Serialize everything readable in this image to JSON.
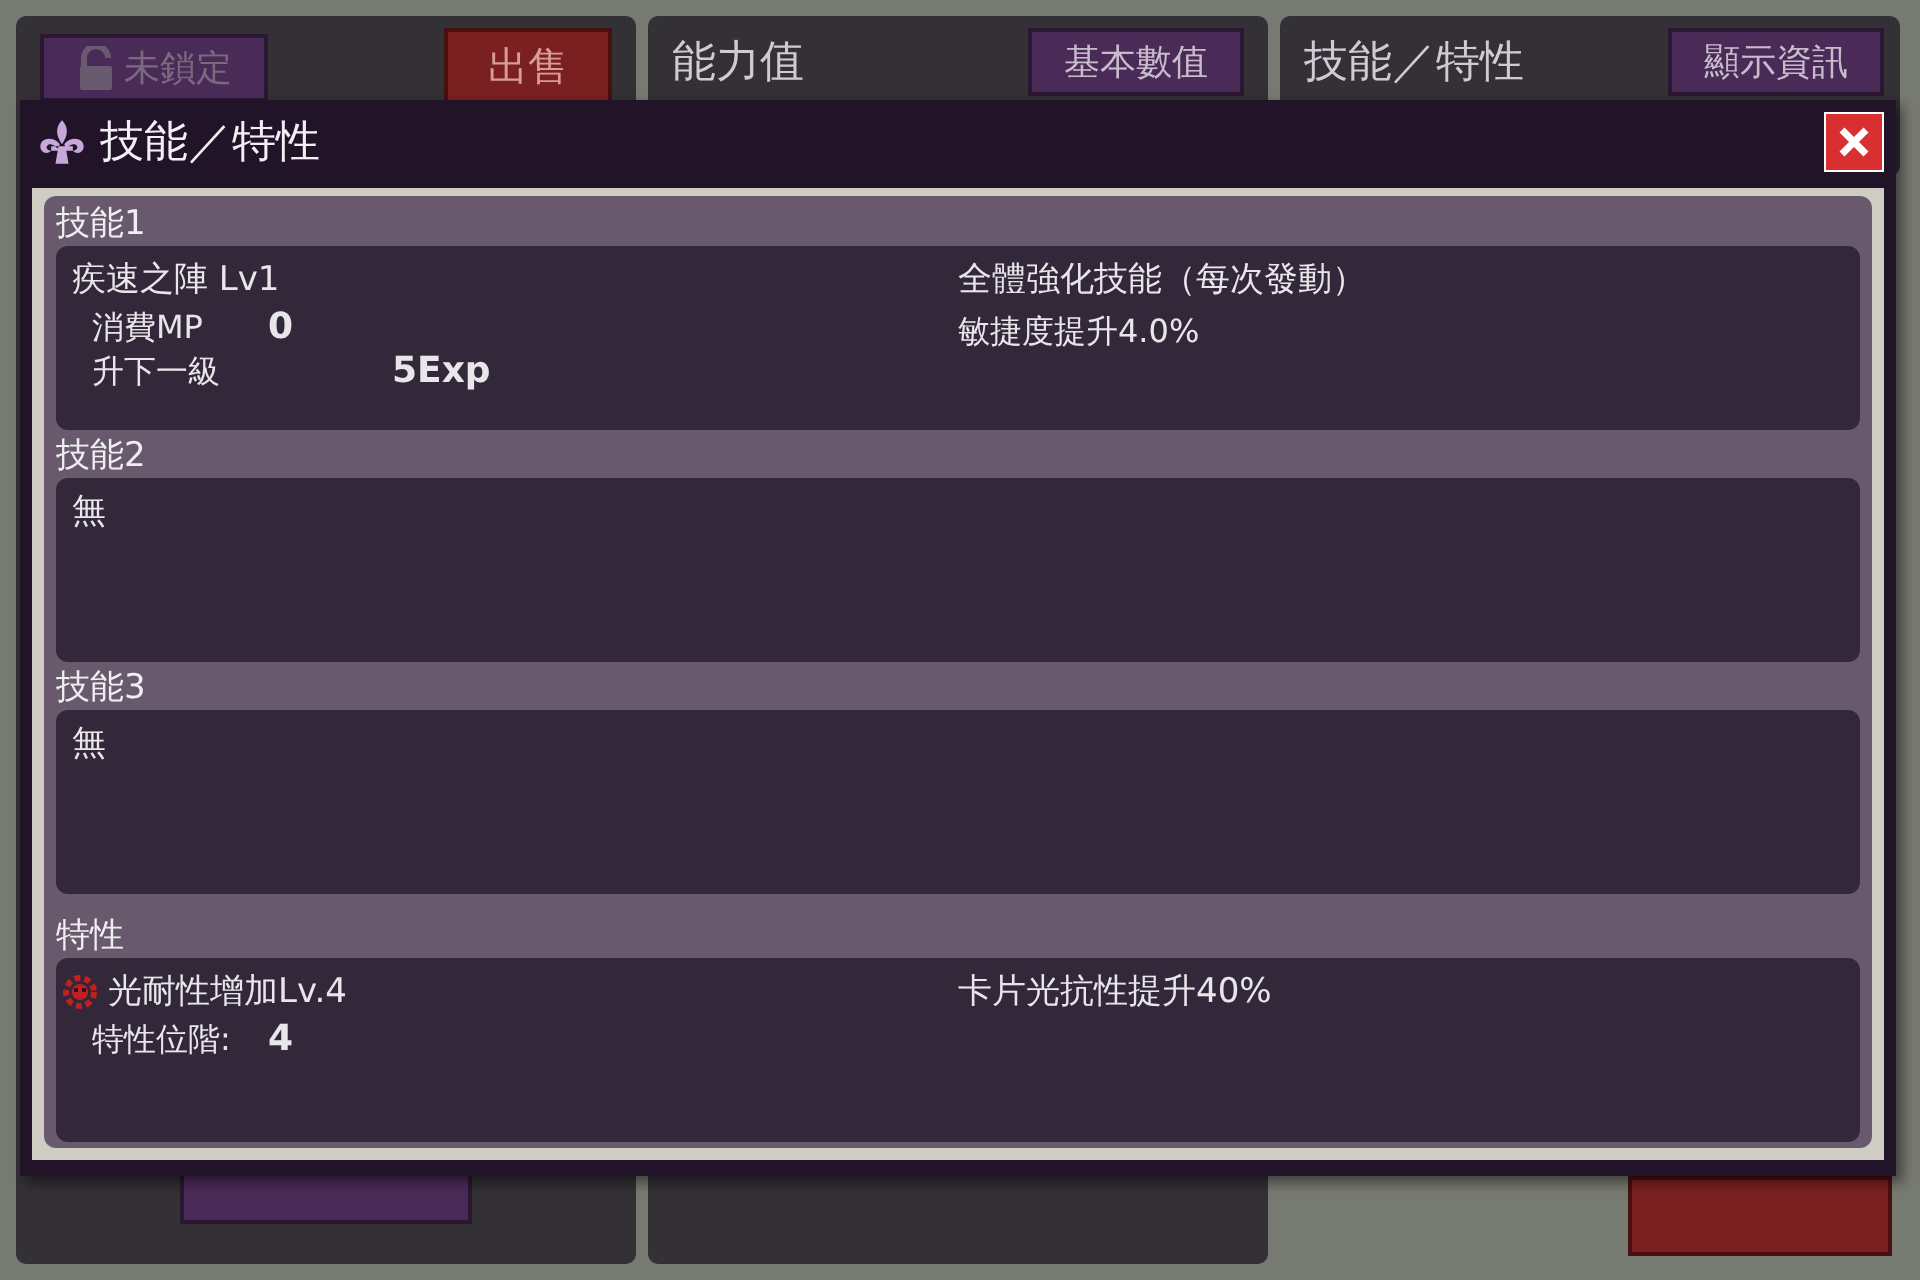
{
  "background": {
    "lock_button": "未鎖定",
    "sell_button": "出售",
    "stats_panel": {
      "title": "能力值",
      "button": "基本數值"
    },
    "skills_panel": {
      "title": "技能／特性",
      "button": "顯示資訊"
    }
  },
  "dialog": {
    "title": "技能／特性",
    "skills": [
      {
        "label": "技能1",
        "name": "疾速之陣 Lv1",
        "type": "全體強化技能（每次發動）",
        "cost_label": "消費MP",
        "cost": "0",
        "next_label": "升下一級",
        "next": "5Exp",
        "effect": "敏捷度提升4.0%"
      },
      {
        "label": "技能2",
        "name": "無"
      },
      {
        "label": "技能3",
        "name": "無"
      }
    ],
    "trait": {
      "label": "特性",
      "name": "光耐性增加Lv.4",
      "effect": "卡片光抗性提升40%",
      "rank_label": "特性位階:",
      "rank": "4"
    }
  }
}
